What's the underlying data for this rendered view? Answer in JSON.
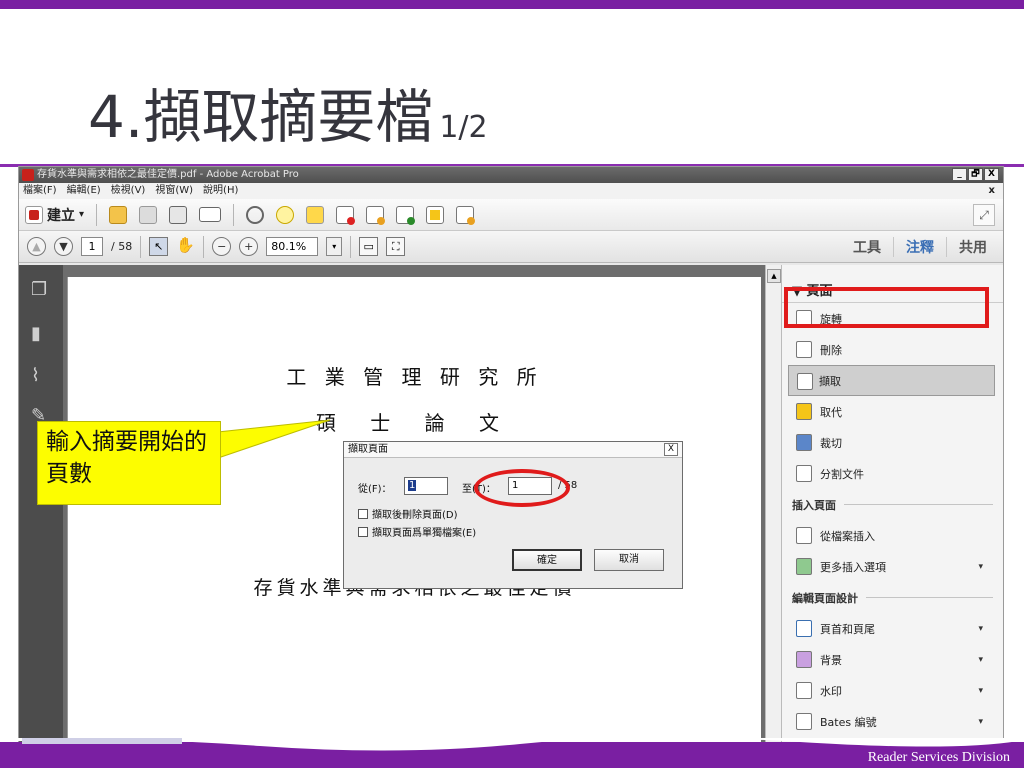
{
  "slide": {
    "title_main": "4.擷取摘要檔",
    "title_sub": "1/2",
    "footer": "Reader Services Division"
  },
  "window": {
    "title": "存貨水準與需求相依之最佳定價.pdf - Adobe Acrobat Pro",
    "controls": [
      "_",
      "🗗",
      "X"
    ],
    "doc_close": "x"
  },
  "menu": [
    "檔案(F)",
    "編輯(E)",
    "檢視(V)",
    "視窗(W)",
    "說明(H)"
  ],
  "toolbar1": {
    "create_label": "建立",
    "create_arrow": "▾",
    "expand": "⤢"
  },
  "toolbar2": {
    "page_current": "1",
    "page_total": "/ 58",
    "zoom": "80.1%",
    "zoom_arrow": "▾",
    "tabs": [
      "工具",
      "注釋",
      "共用"
    ]
  },
  "document": {
    "line1": "工 業 管 理 研 究 所",
    "line2": "碩   士   論   文",
    "line3": "存貨水準與需求相依之最佳定價"
  },
  "dialog": {
    "title": "擷取頁面",
    "close": "X",
    "from_label": "從(F)：",
    "from_value": "1",
    "to_label": "至(T)：",
    "to_value": "1",
    "total": "/ 58",
    "opt_delete": "擷取後刪除頁面(D)",
    "opt_separate": "擷取頁面爲單獨檔案(E)",
    "ok": "確定",
    "cancel": "取消"
  },
  "panel": {
    "section_pages": "▼ 頁面",
    "items_pages": [
      {
        "label": "旋轉",
        "icon": "rotate-icon"
      },
      {
        "label": "刪除",
        "icon": "delete-page-icon"
      },
      {
        "label": "擷取",
        "icon": "extract-icon"
      },
      {
        "label": "取代",
        "icon": "replace-icon"
      },
      {
        "label": "裁切",
        "icon": "crop-icon"
      },
      {
        "label": "分割文件",
        "icon": "split-icon"
      }
    ],
    "section_insert": "插入頁面",
    "items_insert": [
      {
        "label": "從檔案插入",
        "icon": "insert-file-icon"
      },
      {
        "label": "更多插入選項",
        "icon": "more-insert-icon"
      }
    ],
    "section_design": "編輯頁面設計",
    "items_design": [
      {
        "label": "頁首和頁尾",
        "icon": "header-footer-icon"
      },
      {
        "label": "背景",
        "icon": "background-icon"
      },
      {
        "label": "水印",
        "icon": "watermark-icon"
      },
      {
        "label": "Bates 編號",
        "icon": "bates-icon"
      }
    ],
    "dropdown_arrow": "▾"
  },
  "callout": {
    "text": "輸入摘要開始的頁數"
  },
  "colors": {
    "accent_purple": "#7a1fa2",
    "highlight_red": "#e01b1b",
    "callout_yellow": "#fdfd00"
  }
}
